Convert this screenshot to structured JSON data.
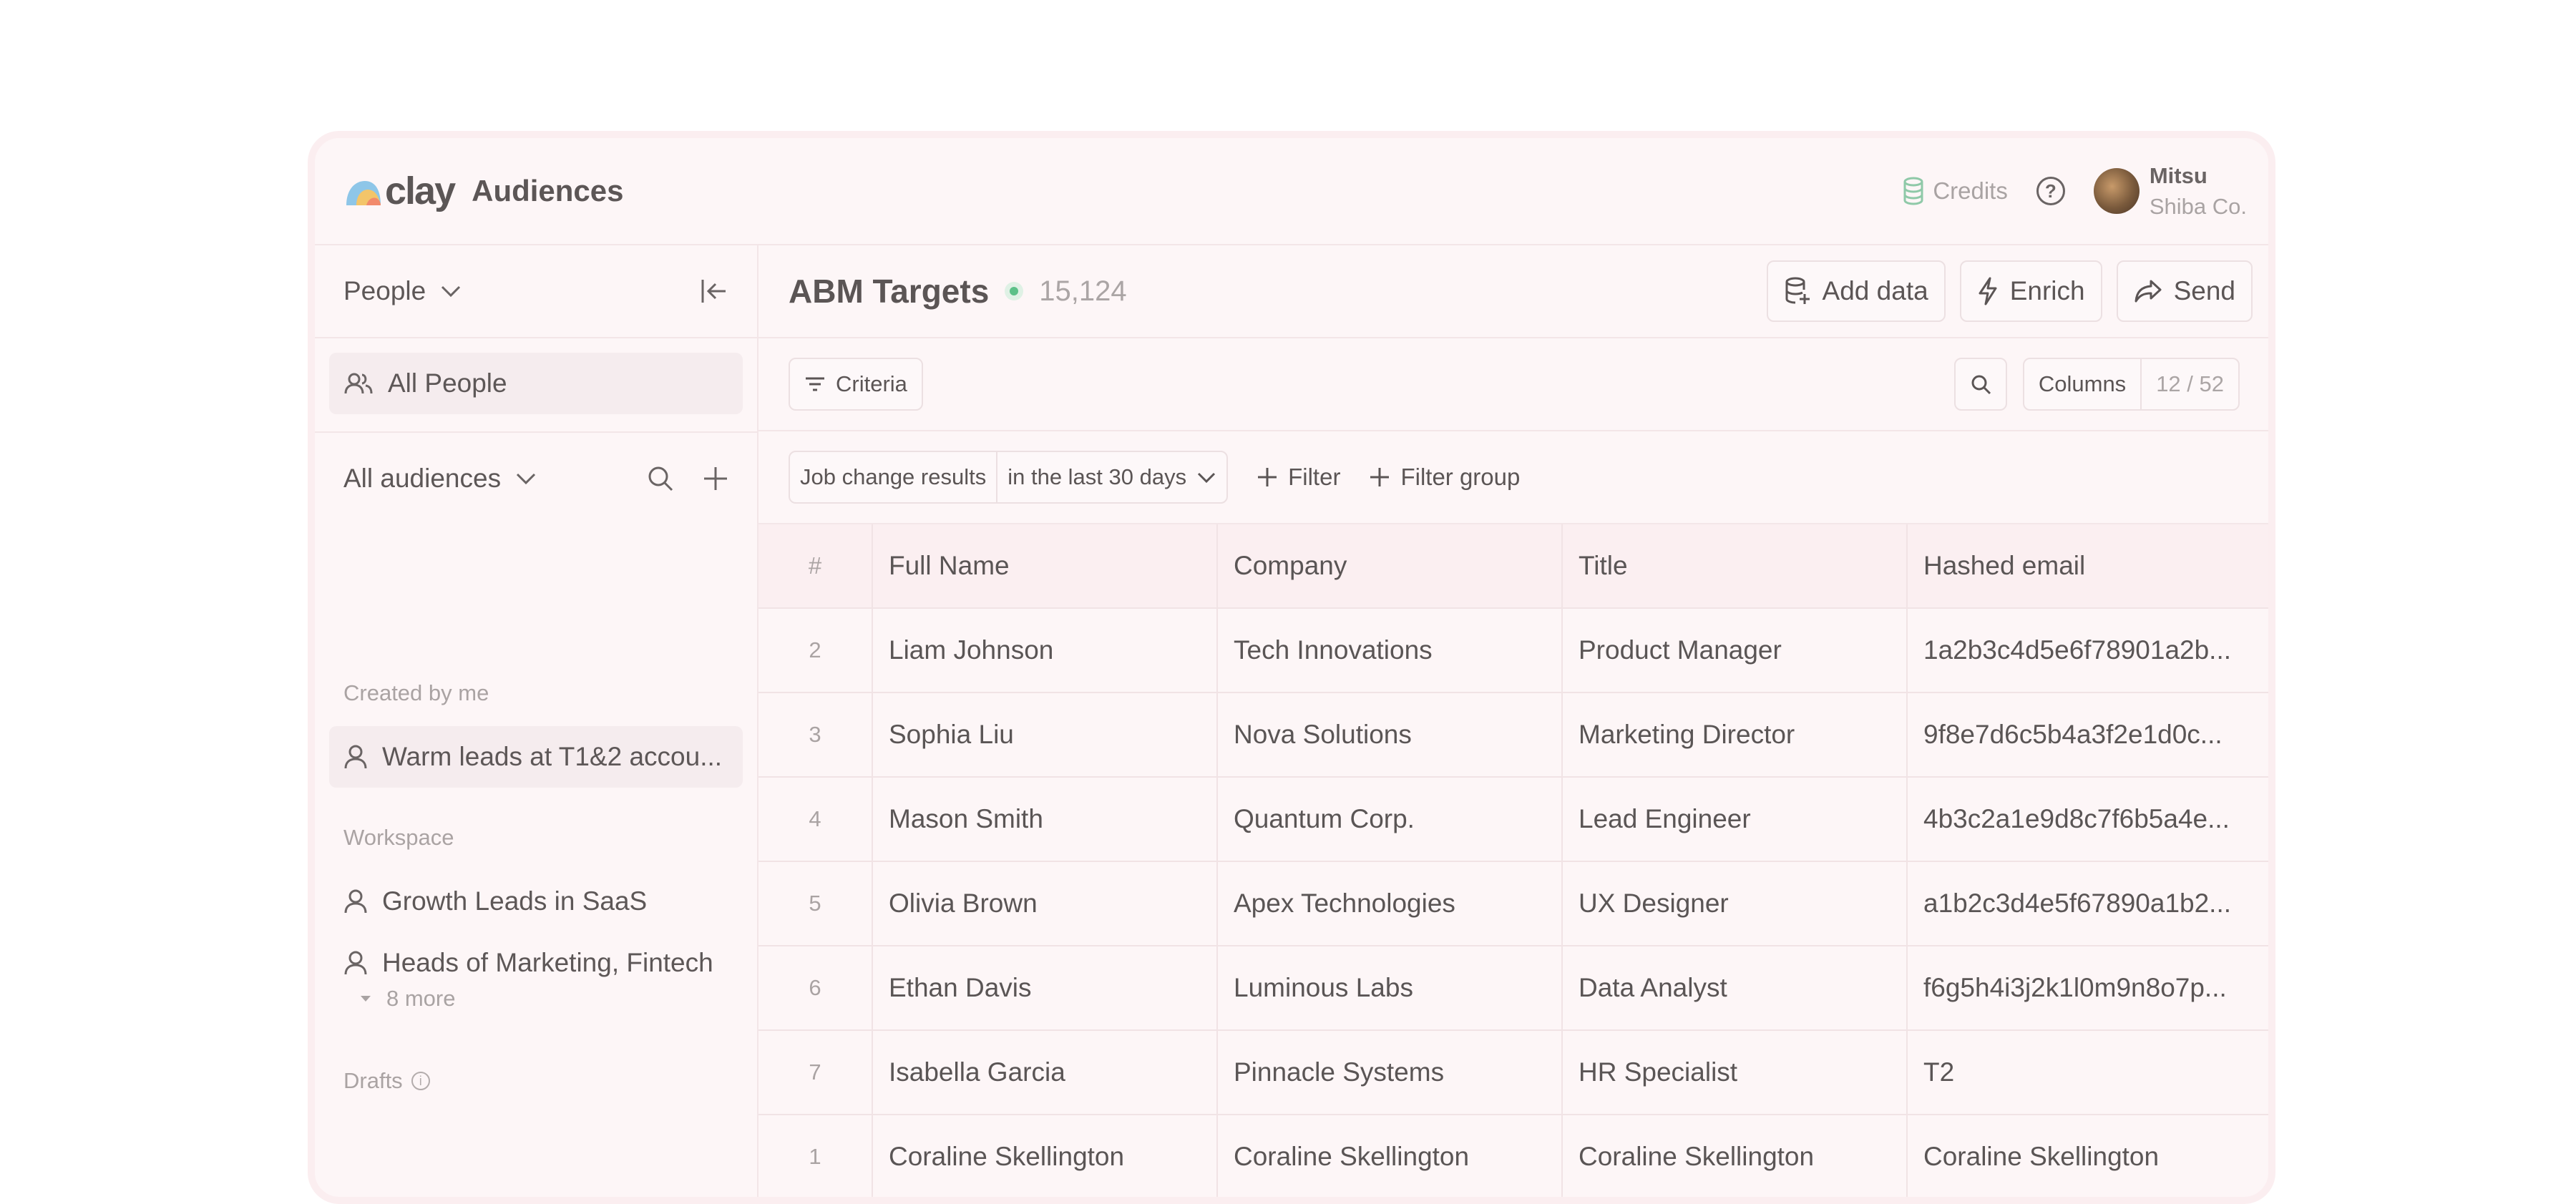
{
  "app": {
    "brand": "clay",
    "title": "Audiences"
  },
  "header": {
    "credits_label": "Credits",
    "user": {
      "name": "Mitsu",
      "org": "Shiba Co."
    }
  },
  "sidebar": {
    "people_selector": "People",
    "all_people": "All People",
    "audiences_selector": "All audiences",
    "sections": {
      "created_by_me": "Created by me",
      "workspace": "Workspace",
      "drafts": "Drafts"
    },
    "created_by_me_items": [
      "Warm leads at T1&2 accou..."
    ],
    "workspace_items": [
      "Growth Leads in SaaS",
      "Heads of Marketing, Fintech"
    ],
    "more_label": "8 more"
  },
  "main": {
    "title": "ABM Targets",
    "count": "15,124",
    "actions": {
      "add_data": "Add data",
      "enrich": "Enrich",
      "send": "Send"
    },
    "criteria_label": "Criteria",
    "columns_label": "Columns",
    "columns_value": "12 / 52",
    "filter": {
      "field": "Job change results",
      "condition": "in the last 30 days"
    },
    "add_filter": "Filter",
    "add_filter_group": "Filter group"
  },
  "table": {
    "headers": [
      "#",
      "Full Name",
      "Company",
      "Title",
      "Hashed email"
    ],
    "rows": [
      [
        "2",
        "Liam Johnson",
        "Tech Innovations",
        "Product Manager",
        "1a2b3c4d5e6f78901a2b..."
      ],
      [
        "3",
        "Sophia Liu",
        "Nova Solutions",
        "Marketing Director",
        "9f8e7d6c5b4a3f2e1d0c..."
      ],
      [
        "4",
        "Mason Smith",
        "Quantum Corp.",
        "Lead Engineer",
        "4b3c2a1e9d8c7f6b5a4e..."
      ],
      [
        "5",
        "Olivia Brown",
        "Apex Technologies",
        "UX Designer",
        "a1b2c3d4e5f67890a1b2..."
      ],
      [
        "6",
        "Ethan Davis",
        "Luminous Labs",
        "Data Analyst",
        "f6g5h4i3j2k1l0m9n8o7p..."
      ],
      [
        "7",
        "Isabella Garcia",
        "Pinnacle Systems",
        "HR Specialist",
        "T2"
      ],
      [
        "1",
        "Coraline Skellington",
        "Coraline Skellington",
        "Coraline Skellington",
        "Coraline Skellington"
      ]
    ]
  },
  "colors": {
    "status_active": "#5cc088",
    "panel_bg": "#fdf6f7",
    "frame_border": "#fbeef0"
  }
}
